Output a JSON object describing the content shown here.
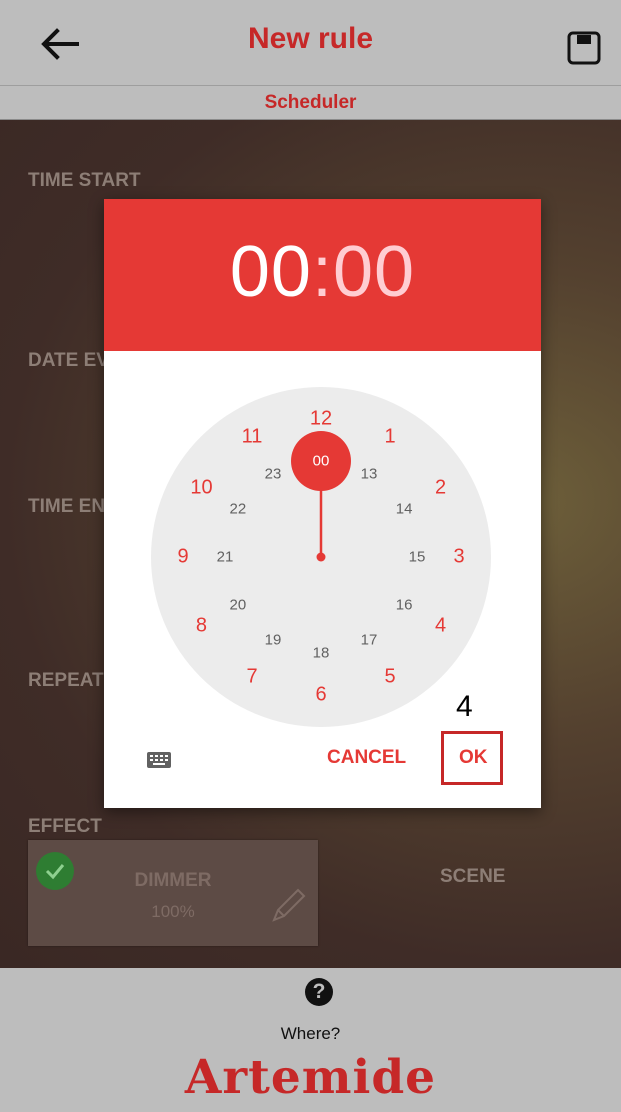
{
  "header": {
    "title": "New rule",
    "subtitle": "Scheduler",
    "back_icon": "arrow-left-icon",
    "save_icon": "floppy-disk-icon"
  },
  "form": {
    "time_start_label": "TIME START",
    "date_label_partial": "DATE EV",
    "time_end_label_partial": "TIME EN",
    "repeat_label_partial": "REPEAT",
    "effect_label": "EFFECT",
    "dimmer": {
      "label": "DIMMER",
      "value": "100%",
      "selected": true
    },
    "scene": {
      "label": "SCENE"
    }
  },
  "time_picker": {
    "hours": "00",
    "colon": ":",
    "minutes": "00",
    "selected_hour": "00",
    "outer_hours": [
      "12",
      "1",
      "2",
      "3",
      "4",
      "5",
      "6",
      "7",
      "8",
      "9",
      "10",
      "11"
    ],
    "inner_hours": [
      "00",
      "13",
      "14",
      "15",
      "16",
      "17",
      "18",
      "19",
      "20",
      "21",
      "22",
      "23"
    ],
    "cancel_label": "CANCEL",
    "ok_label": "OK",
    "keyboard_icon": "keyboard-icon"
  },
  "footer": {
    "help_icon": "question-circle-icon",
    "help_glyph": "?",
    "where_label": "Where?",
    "logo_text": "Artemide"
  },
  "annotation": {
    "label": "4"
  },
  "colors": {
    "accent_red": "#e53935",
    "title_red": "#c62828",
    "header_gray": "#bdbdbd",
    "check_green": "#2e7d32"
  }
}
